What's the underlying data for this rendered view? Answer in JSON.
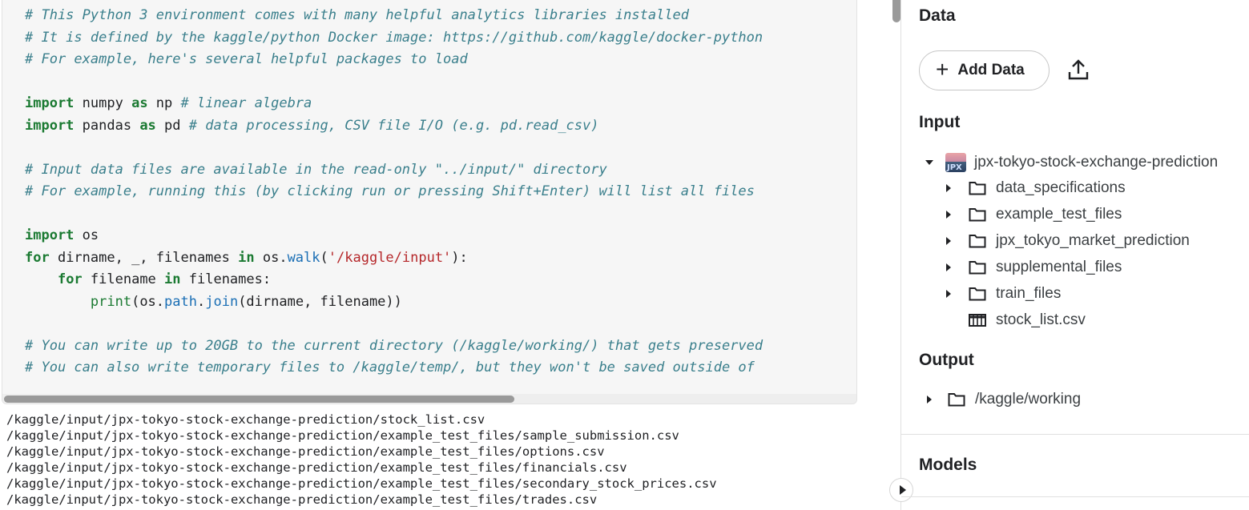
{
  "code_cell": {
    "lines": [
      [
        {
          "t": "# This Python 3 environment comes with many helpful analytics libraries installed",
          "c": "com"
        }
      ],
      [
        {
          "t": "# It is defined by the kaggle/python Docker image: https://github.com/kaggle/docker-python",
          "c": "com"
        }
      ],
      [
        {
          "t": "# For example, here's several helpful packages to load",
          "c": "com"
        }
      ],
      [],
      [
        {
          "t": "import",
          "c": "kw"
        },
        {
          "t": " numpy "
        },
        {
          "t": "as",
          "c": "kw"
        },
        {
          "t": " np "
        },
        {
          "t": "# linear algebra",
          "c": "com"
        }
      ],
      [
        {
          "t": "import",
          "c": "kw"
        },
        {
          "t": " pandas "
        },
        {
          "t": "as",
          "c": "kw"
        },
        {
          "t": " pd "
        },
        {
          "t": "# data processing, CSV file I/O (e.g. pd.read_csv)",
          "c": "com"
        }
      ],
      [],
      [
        {
          "t": "# Input data files are available in the read-only \"../input/\" directory",
          "c": "com"
        }
      ],
      [
        {
          "t": "# For example, running this (by clicking run or pressing Shift+Enter) will list all files",
          "c": "com"
        }
      ],
      [],
      [
        {
          "t": "import",
          "c": "kw"
        },
        {
          "t": " os"
        }
      ],
      [
        {
          "t": "for",
          "c": "kw"
        },
        {
          "t": " dirname, _, filenames "
        },
        {
          "t": "in",
          "c": "kw"
        },
        {
          "t": " os."
        },
        {
          "t": "walk",
          "c": "fn"
        },
        {
          "t": "("
        },
        {
          "t": "'/kaggle/input'",
          "c": "str"
        },
        {
          "t": "):"
        }
      ],
      [
        {
          "t": "    "
        },
        {
          "t": "for",
          "c": "kw"
        },
        {
          "t": " filename "
        },
        {
          "t": "in",
          "c": "kw"
        },
        {
          "t": " filenames:"
        }
      ],
      [
        {
          "t": "        "
        },
        {
          "t": "print",
          "c": "bi"
        },
        {
          "t": "(os."
        },
        {
          "t": "path",
          "c": "fn"
        },
        {
          "t": "."
        },
        {
          "t": "join",
          "c": "fn"
        },
        {
          "t": "(dirname, filename))"
        }
      ],
      [],
      [
        {
          "t": "# You can write up to 20GB to the current directory (/kaggle/working/) that gets preserved",
          "c": "com"
        }
      ],
      [
        {
          "t": "# You can also write temporary files to /kaggle/temp/, but they won't be saved outside of",
          "c": "com"
        }
      ]
    ]
  },
  "output_lines": [
    "/kaggle/input/jpx-tokyo-stock-exchange-prediction/stock_list.csv",
    "/kaggle/input/jpx-tokyo-stock-exchange-prediction/example_test_files/sample_submission.csv",
    "/kaggle/input/jpx-tokyo-stock-exchange-prediction/example_test_files/options.csv",
    "/kaggle/input/jpx-tokyo-stock-exchange-prediction/example_test_files/financials.csv",
    "/kaggle/input/jpx-tokyo-stock-exchange-prediction/example_test_files/secondary_stock_prices.csv",
    "/kaggle/input/jpx-tokyo-stock-exchange-prediction/example_test_files/trades.csv"
  ],
  "panel": {
    "data_title": "Data",
    "add_data_label": "Add Data",
    "add_data_icon": "plus-icon",
    "upload_icon": "upload-icon",
    "input_title": "Input",
    "dataset": {
      "name": "jpx-tokyo-stock-exchange-prediction",
      "thumb_text": "JPX",
      "items": [
        {
          "name": "data_specifications",
          "type": "folder"
        },
        {
          "name": "example_test_files",
          "type": "folder"
        },
        {
          "name": "jpx_tokyo_market_prediction",
          "type": "folder"
        },
        {
          "name": "supplemental_files",
          "type": "folder"
        },
        {
          "name": "train_files",
          "type": "folder"
        },
        {
          "name": "stock_list.csv",
          "type": "table"
        }
      ]
    },
    "output_title": "Output",
    "output_item": "/kaggle/working",
    "models_title": "Models"
  }
}
